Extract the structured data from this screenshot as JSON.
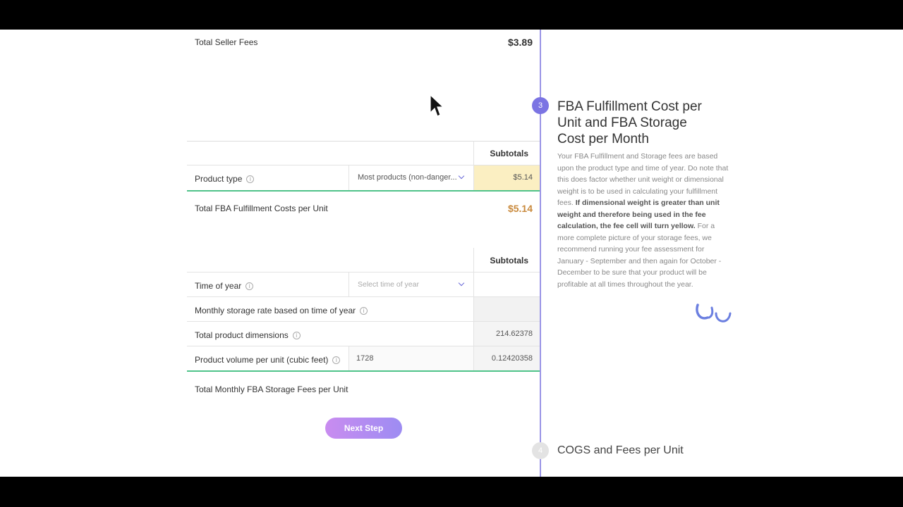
{
  "seller_fees": {
    "label": "Total Seller Fees",
    "value": "$3.89"
  },
  "fulfillment": {
    "subtotals_header": "Subtotals",
    "product_type_label": "Product type",
    "product_type_value": "Most products (non-danger...",
    "product_type_subtotal": "$5.14",
    "total_label": "Total FBA Fulfillment Costs per Unit",
    "total_value": "$5.14"
  },
  "storage": {
    "subtotals_header": "Subtotals",
    "time_of_year_label": "Time of year",
    "time_of_year_placeholder": "Select time of year",
    "monthly_rate_label": "Monthly storage rate based on time of year",
    "dimensions_label": "Total product dimensions",
    "dimensions_value": "214.62378",
    "volume_label": "Product volume per unit (cubic feet)",
    "volume_input": "1728",
    "volume_value": "0.12420358",
    "total_label": "Total Monthly FBA Storage Fees per Unit"
  },
  "next_button": "Next Step",
  "step3": {
    "number": "3",
    "title_line1": "FBA Fulfillment Cost per",
    "title_line2": "Unit and FBA Storage",
    "title_line3": "Cost per Month",
    "desc_part1": "Your FBA Fulfillment and Storage fees are based upon the product type and time of year. Do note that this does factor whether unit weight or dimensional weight is to be used in calculating your fulfillment fees. ",
    "desc_bold": "If dimensional weight is greater than unit weight and therefore being used in the fee calculation, the fee cell will turn yellow.",
    "desc_part2": " For a more complete picture of your storage fees, we recommend running your fee assessment for January - September and then again for October - December to be sure that your product will be profitable at all times throughout the year."
  },
  "step4": {
    "number": "4",
    "title": "COGS and Fees per Unit"
  },
  "info_glyph": "i",
  "colors": {
    "accent": "#7b74e3",
    "highlight": "#fbefc2",
    "success_line": "#4fc38a",
    "total_orange": "#c98a3d"
  }
}
